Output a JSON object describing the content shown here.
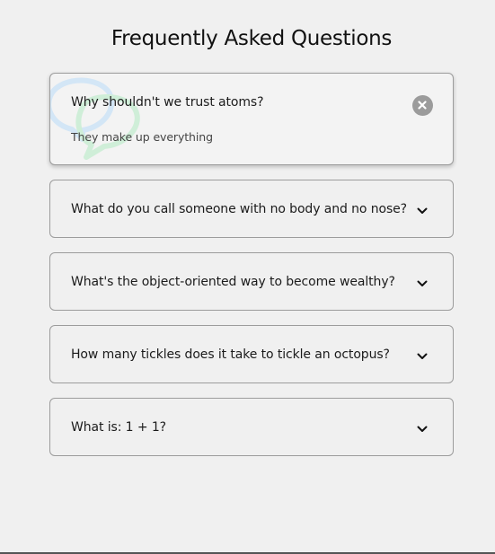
{
  "page": {
    "title": "Frequently Asked Questions"
  },
  "faqs": [
    {
      "question": "Why shouldn't we trust atoms?",
      "answer": "They make up everything",
      "expanded": true,
      "toggle_icon": "close-icon"
    },
    {
      "question": "What do you call someone with no body and no nose?",
      "expanded": false,
      "toggle_icon": "chevron-down-icon"
    },
    {
      "question": "What's the object-oriented way to become wealthy?",
      "expanded": false,
      "toggle_icon": "chevron-down-icon"
    },
    {
      "question": "How many tickles does it take to tickle an octopus?",
      "expanded": false,
      "toggle_icon": "chevron-down-icon"
    },
    {
      "question": "What is: 1 + 1?",
      "expanded": false,
      "toggle_icon": "chevron-down-icon"
    }
  ],
  "colors": {
    "background": "#f0f0f0",
    "border": "#9c9c9c",
    "close_button": "#9b9b9b",
    "bubble_blue": "#cfe3f5",
    "bubble_green": "#cdeed6"
  }
}
